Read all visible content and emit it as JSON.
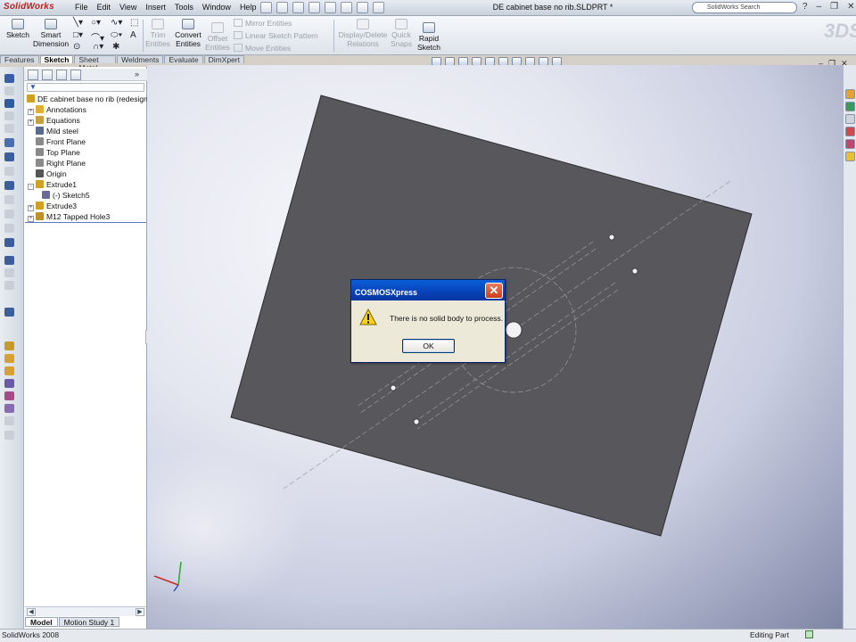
{
  "app": {
    "name": "SolidWorks",
    "document_title": "DE cabinet base no rib.SLDPRT *",
    "search_placeholder": "SolidWorks Search"
  },
  "menu": [
    "File",
    "Edit",
    "View",
    "Insert",
    "Tools",
    "Window",
    "Help"
  ],
  "command_manager": {
    "sketch": "Sketch",
    "smart_dimension": [
      "Smart",
      "Dimension"
    ],
    "trim_entities": [
      "Trim",
      "Entities"
    ],
    "convert_entities": [
      "Convert",
      "Entities"
    ],
    "offset_entities": [
      "Offset",
      "Entities"
    ],
    "mirror_entities": "Mirror Entities",
    "linear_pattern": "Linear Sketch Pattern",
    "move_entities": "Move Entities",
    "display_delete_relations": [
      "Display/Delete",
      "Relations"
    ],
    "quick_snaps": [
      "Quick",
      "Snaps"
    ],
    "rapid_sketch": [
      "Rapid",
      "Sketch"
    ]
  },
  "tabs": [
    {
      "label": "Features",
      "active": false
    },
    {
      "label": "Sketch",
      "active": true
    },
    {
      "label": "Sheet Metal",
      "active": false
    },
    {
      "label": "Weldments",
      "active": false
    },
    {
      "label": "Evaluate",
      "active": false
    },
    {
      "label": "DimXpert",
      "active": false
    }
  ],
  "feature_tree": {
    "root": "DE cabinet base no rib  (redesign)",
    "items": [
      {
        "label": "Annotations",
        "expander": "+",
        "icon": "annotations-icon"
      },
      {
        "label": "Equations",
        "expander": "+",
        "icon": "equations-icon"
      },
      {
        "label": "Mild steel",
        "expander": "",
        "icon": "material-icon"
      },
      {
        "label": "Front Plane",
        "expander": "",
        "icon": "plane-icon"
      },
      {
        "label": "Top Plane",
        "expander": "",
        "icon": "plane-icon"
      },
      {
        "label": "Right Plane",
        "expander": "",
        "icon": "plane-icon"
      },
      {
        "label": "Origin",
        "expander": "",
        "icon": "origin-icon"
      },
      {
        "label": "Extrude1",
        "expander": "-",
        "icon": "extrude-icon"
      },
      {
        "label": "(-) Sketch5",
        "expander": "",
        "icon": "sketch-icon"
      },
      {
        "label": "Extrude3",
        "expander": "+",
        "icon": "extrude-icon"
      },
      {
        "label": "M12 Tapped Hole3",
        "expander": "+",
        "icon": "hole-icon"
      }
    ]
  },
  "bottom_tabs": [
    {
      "label": "Model",
      "active": true
    },
    {
      "label": "Motion Study 1",
      "active": false
    }
  ],
  "dialog": {
    "title": "COSMOSXpress",
    "message": "There is no solid body to process.",
    "ok_label": "OK",
    "icon": "warning-icon"
  },
  "status": {
    "left": "SolidWorks 2008",
    "right": "Editing Part"
  },
  "colors": {
    "plate": "#57575c",
    "dialog_title": "#0842b8",
    "close_button": "#c8401e"
  }
}
